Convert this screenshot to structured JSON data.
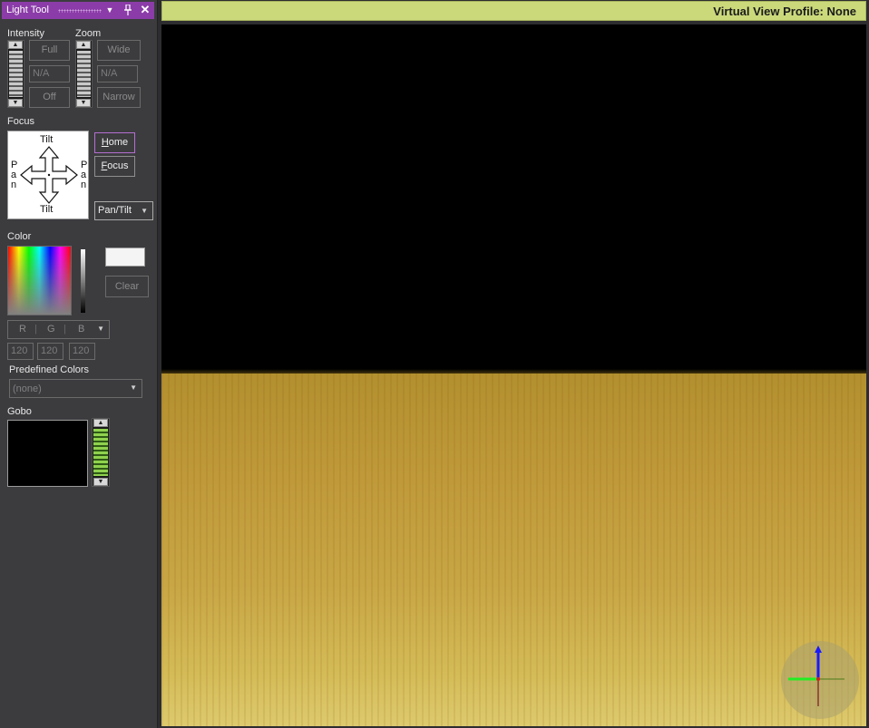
{
  "panel": {
    "title": "Light Tool",
    "pin_icon": "pin-icon",
    "close_icon": "close-icon",
    "menu_icon": "dropdown-menu-icon"
  },
  "intensity": {
    "label": "Intensity",
    "full": "Full",
    "value": "N/A",
    "off": "Off"
  },
  "zoom": {
    "label": "Zoom",
    "wide": "Wide",
    "value": "N/A",
    "narrow": "Narrow"
  },
  "focus": {
    "label": "Focus",
    "pad_top": "Tilt",
    "pad_bottom": "Tilt",
    "pad_left": [
      "P",
      "a",
      "n"
    ],
    "pad_right": [
      "P",
      "a",
      "n"
    ],
    "home_key": "H",
    "home_rest": "ome",
    "focus_key": "F",
    "focus_rest": "ocus",
    "mode": "Pan/Tilt"
  },
  "color": {
    "label": "Color",
    "clear": "Clear",
    "mode_r": "R",
    "mode_g": "G",
    "mode_b": "B",
    "r": "120",
    "g": "120",
    "b": "120",
    "swatch_color": "#f4f4f4"
  },
  "predefined": {
    "label": "Predefined Colors",
    "value": "(none)"
  },
  "gobo": {
    "label": "Gobo"
  },
  "viewport": {
    "title": "Virtual View Profile: None",
    "bar_color": "#cbd97b"
  }
}
